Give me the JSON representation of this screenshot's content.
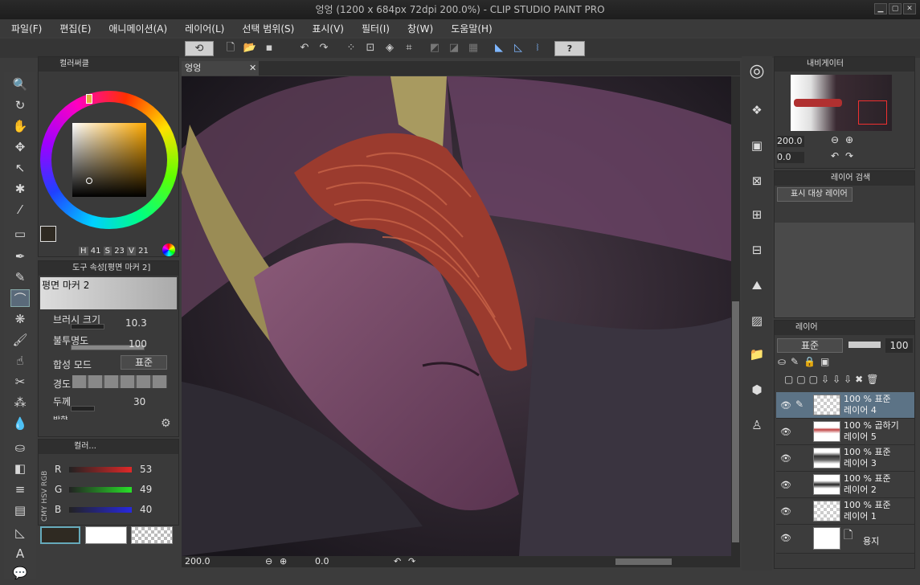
{
  "window": {
    "title": "엉엉 (1200 x 684px 72dpi 200.0%)  - CLIP STUDIO PAINT PRO",
    "min": "▁",
    "max": "▢",
    "close": "✕"
  },
  "menu": [
    "파일(F)",
    "편집(E)",
    "애니메이션(A)",
    "레이어(L)",
    "선택 범위(S)",
    "표시(V)",
    "필터(I)",
    "창(W)",
    "도움말(H)"
  ],
  "canvas_tab": {
    "label": "엉엉",
    "close": "✕"
  },
  "color_panel": {
    "tab_label": "컬러써클",
    "h_label": "H",
    "h": "41",
    "s_label": "S",
    "s": "23",
    "v_label": "V",
    "v": "21",
    "main_color": "#2f2a22"
  },
  "tool_property": {
    "tab_label": "도구 속성[평면 마커 2]",
    "preset_name": "평면 마커 2",
    "rows": [
      {
        "label": "브러시 크기",
        "value": "10.3"
      },
      {
        "label": "불투명도",
        "value": "100"
      },
      {
        "label": "합성 모드",
        "value": "표준"
      },
      {
        "label": "경도",
        "value": ""
      },
      {
        "label": "두께",
        "value": "30"
      }
    ],
    "cut_label": "방향"
  },
  "color_slider": {
    "tab_label": "컬러...",
    "rgb": "RGB",
    "hsv": "HSV",
    "cmy": "CMY",
    "channels": [
      {
        "label": "R",
        "value": "53",
        "color": "#d03030"
      },
      {
        "label": "G",
        "value": "49",
        "color": "#30c030"
      },
      {
        "label": "B",
        "value": "40",
        "color": "#3030d0"
      }
    ]
  },
  "status": {
    "zoom": "200.0",
    "angle": "0.0"
  },
  "navigator": {
    "tab_label": "내비게이터",
    "zoom": "200.0",
    "angle": "0.0"
  },
  "layer_search": {
    "tab_label": "레이어 검색",
    "filter": "표시 대상 레이어"
  },
  "layers_panel": {
    "tab_label": "레이어",
    "blend": "표준",
    "opacity": "100",
    "layers": [
      {
        "mode": "100 % 표준",
        "name": "레이어 4",
        "selected": true
      },
      {
        "mode": "100 % 곱하기",
        "name": "레이어 5",
        "selected": false
      },
      {
        "mode": "100 % 표준",
        "name": "레이어 3",
        "selected": false
      },
      {
        "mode": "100 % 표준",
        "name": "레이어 2",
        "selected": false
      },
      {
        "mode": "100 % 표준",
        "name": "레이어 1",
        "selected": false
      }
    ],
    "paper": "용지"
  }
}
